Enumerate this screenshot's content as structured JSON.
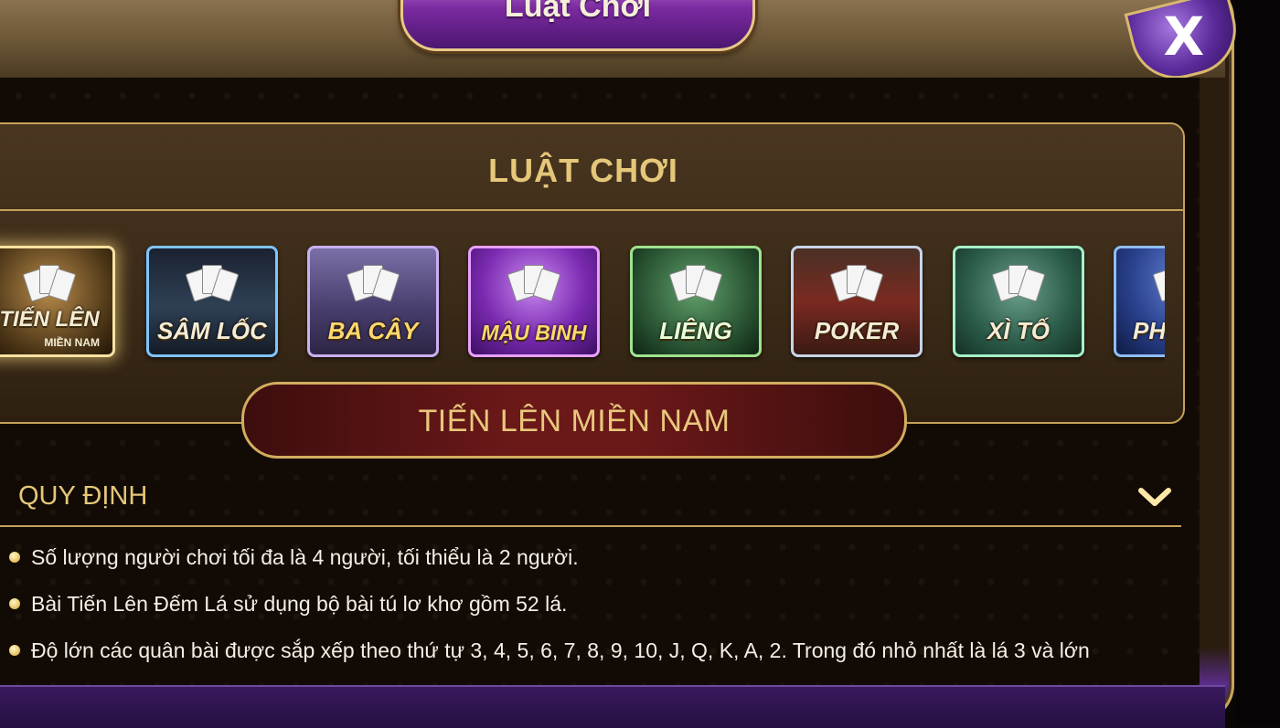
{
  "window": {
    "title": "Luật Chơi",
    "close_label": "X"
  },
  "panel": {
    "heading": "LUẬT CHƠI"
  },
  "games": [
    {
      "label": "TIẾN LÊN",
      "sub": "MIỀN NAM",
      "selected": true
    },
    {
      "label": "SÂM LỐC",
      "sub": ""
    },
    {
      "label": "BA CÂY",
      "sub": ""
    },
    {
      "label": "MẬU BINH",
      "sub": ""
    },
    {
      "label": "LIÊNG",
      "sub": ""
    },
    {
      "label": "POKER",
      "sub": ""
    },
    {
      "label": "XÌ TỐ",
      "sub": ""
    },
    {
      "label": "PHỎ",
      "sub": ""
    }
  ],
  "selected_game": "TIẾN LÊN MIỀN NAM",
  "section": {
    "title": "QUY ĐỊNH",
    "expanded": true
  },
  "rules": [
    "Số lượng người chơi tối đa là 4 người, tối thiểu là 2 người.",
    "Bài Tiến Lên Đếm Lá sử dụng bộ bài tú lơ khơ gồm 52 lá.",
    "Độ lớn các quân bài được sắp xếp theo thứ tự 3, 4, 5, 6, 7, 8, 9, 10, J, Q, K, A, 2. Trong đó nhỏ nhất là lá 3 và lớn"
  ],
  "icons": {
    "close": "close-icon",
    "chevron": "chevron-down-icon",
    "bullet": "bullet-dot-icon"
  },
  "colors": {
    "gold": "#e5c77a",
    "purple": "#7a2aa0",
    "dark_bg": "#120b05",
    "maroon": "#6a1818"
  }
}
